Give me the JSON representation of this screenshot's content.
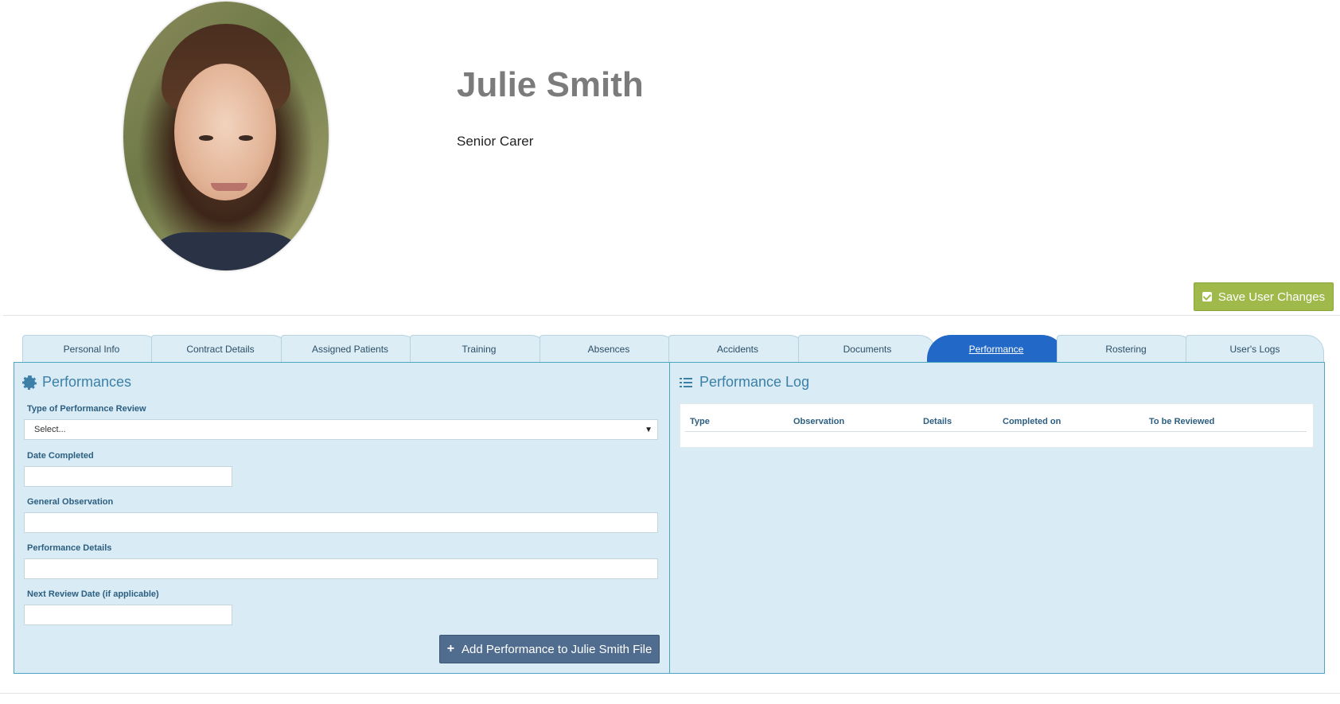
{
  "profile": {
    "name": "Julie Smith",
    "role": "Senior Carer",
    "photo_alt": "profile-photo"
  },
  "toolbar": {
    "save_label": "Save User Changes"
  },
  "tabs": [
    {
      "label": "Personal Info",
      "active": false
    },
    {
      "label": "Contract Details",
      "active": false
    },
    {
      "label": "Assigned Patients",
      "active": false
    },
    {
      "label": "Training",
      "active": false
    },
    {
      "label": "Absences",
      "active": false
    },
    {
      "label": "Accidents",
      "active": false
    },
    {
      "label": "Documents",
      "active": false
    },
    {
      "label": "Performance",
      "active": true
    },
    {
      "label": "Rostering",
      "active": false
    },
    {
      "label": "User's Logs",
      "active": false
    }
  ],
  "form": {
    "title": "Performances",
    "type_label": "Type of Performance Review",
    "type_value": "Select...",
    "date_completed_label": "Date Completed",
    "date_completed_value": "",
    "general_observation_label": "General Observation",
    "general_observation_value": "",
    "performance_details_label": "Performance Details",
    "performance_details_value": "",
    "next_review_label": "Next Review Date (if applicable)",
    "next_review_value": "",
    "add_button_label": "Add Performance to Julie Smith File"
  },
  "log": {
    "title": "Performance Log",
    "columns": [
      "Type",
      "Observation",
      "Details",
      "Completed on",
      "To be Reviewed"
    ],
    "rows": []
  },
  "colors": {
    "save_button": "#9fba4b",
    "active_tab": "#2268c6",
    "panel_bg": "#d9ecf5",
    "add_button": "#506d8f"
  }
}
